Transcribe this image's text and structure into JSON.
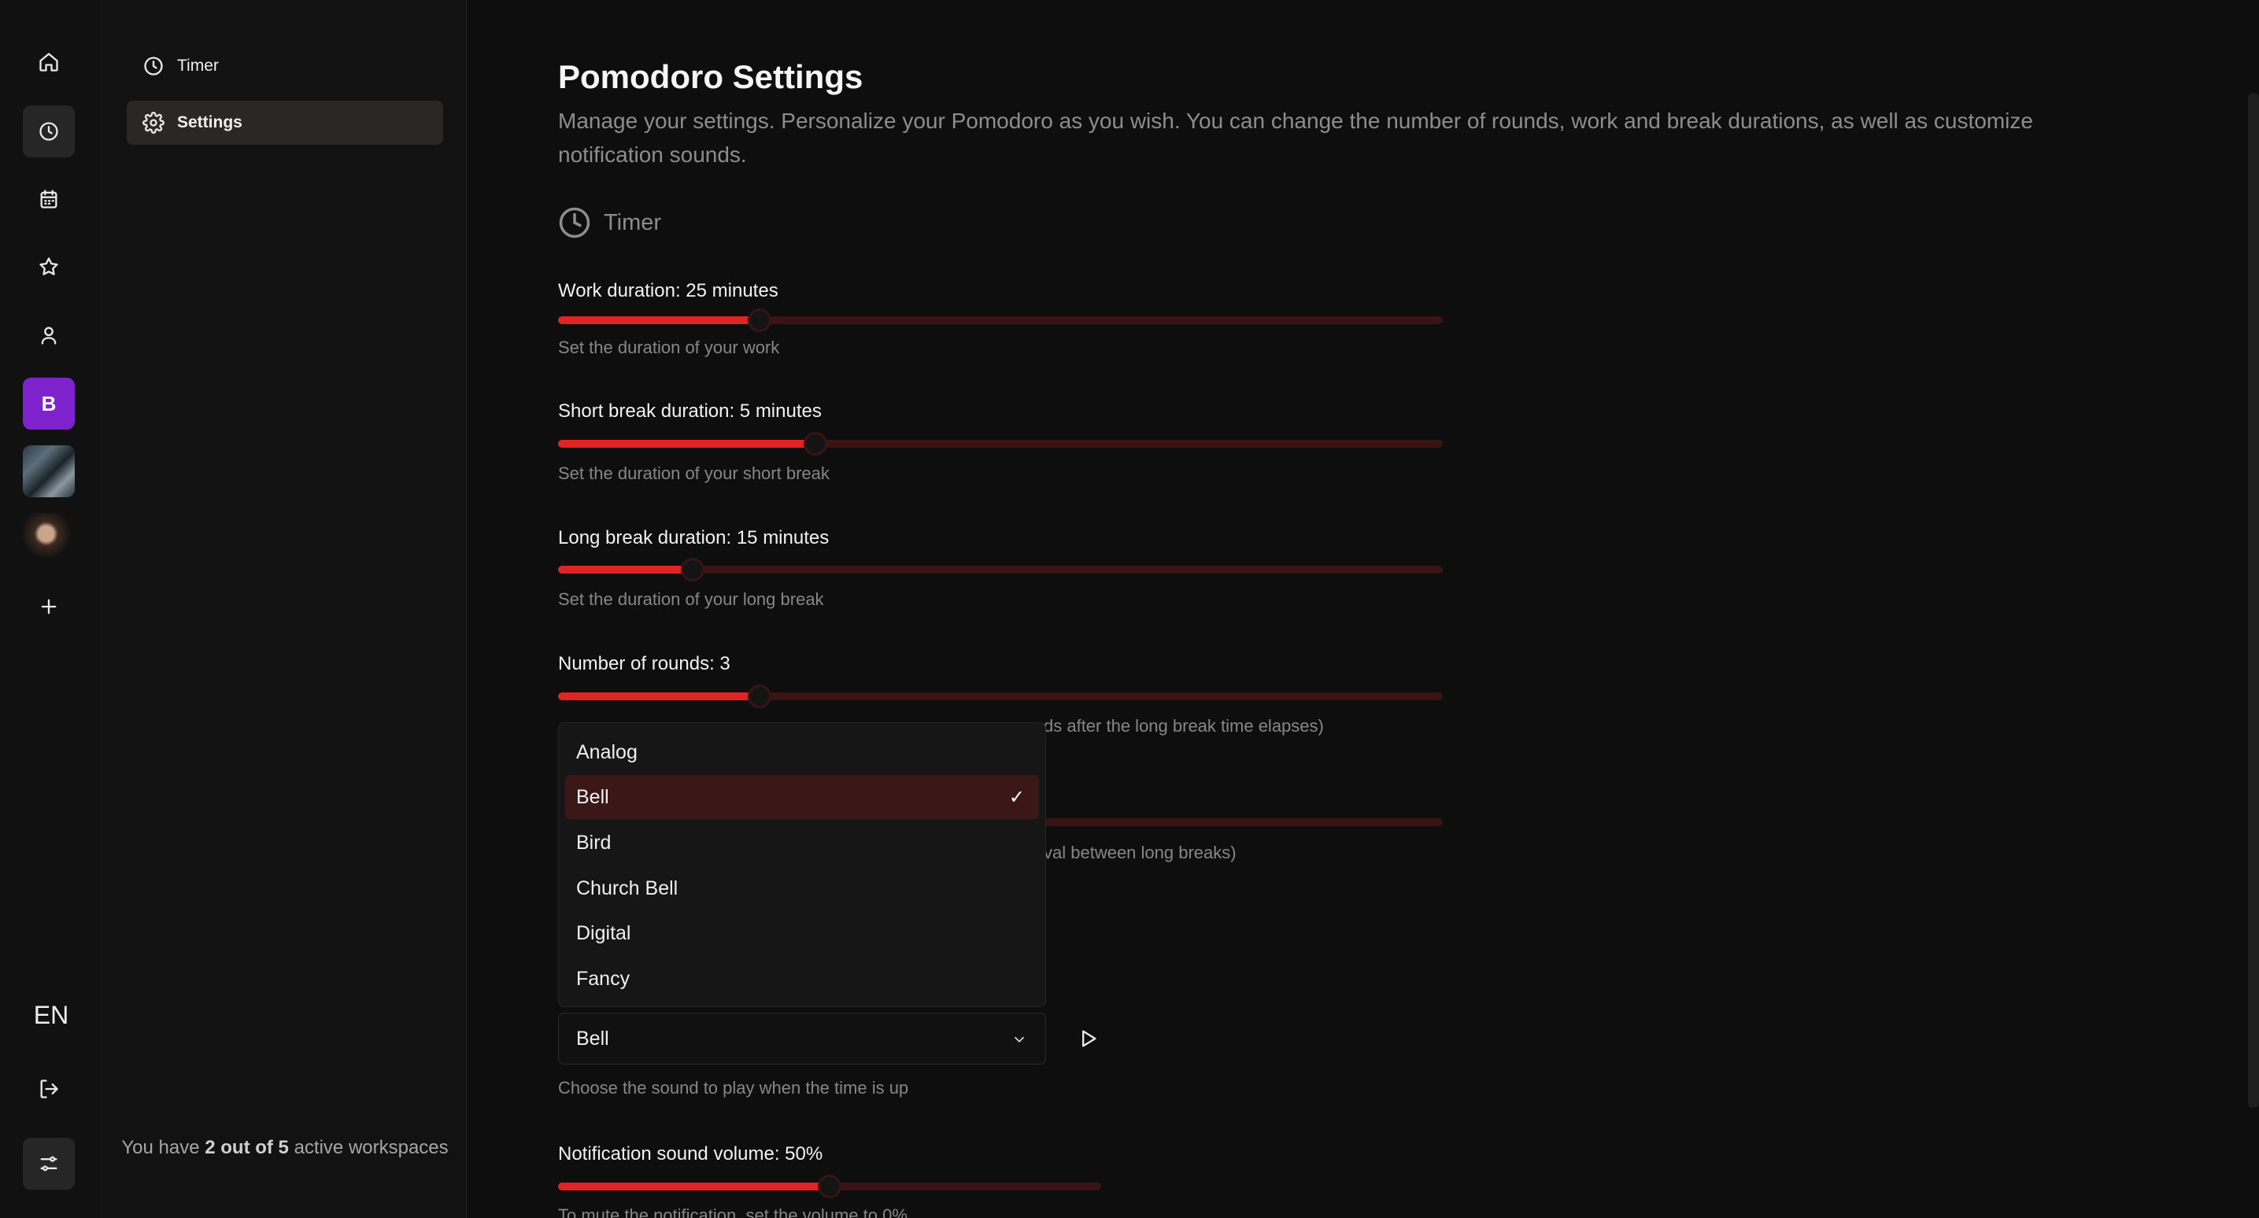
{
  "rail": {
    "lang": "EN",
    "workspace_b": "B"
  },
  "sidebar": {
    "items": [
      {
        "label": "Timer"
      },
      {
        "label": "Settings"
      }
    ],
    "ws_note_prefix": "You have ",
    "ws_note_count": "2 out of 5",
    "ws_note_suffix": " active workspaces"
  },
  "main": {
    "title": "Pomodoro Settings",
    "description": "Manage your settings. Personalize your Pomodoro as you wish. You can change the number of rounds, work and break durations, as well as customize notification sounds.",
    "section": "Timer",
    "sliders": [
      {
        "label": "Work duration: 25 minutes",
        "hint": "Set the duration of your work",
        "fraction": 0.228
      },
      {
        "label": "Short break duration: 5 minutes",
        "hint": "Set the duration of your short break",
        "fraction": 0.291
      },
      {
        "label": "Long break duration: 15 minutes",
        "hint": "Set the duration of your long break",
        "fraction": 0.152
      },
      {
        "label": "Number of rounds: 3",
        "hint_tail": "ds after the long break time elapses)",
        "fraction": 0.228
      },
      {
        "hint_tail": "val between long breaks)"
      }
    ],
    "sound": {
      "options": [
        "Analog",
        "Bell",
        "Bird",
        "Church Bell",
        "Digital",
        "Fancy"
      ],
      "selected": "Bell",
      "check": "✓",
      "hint": "Choose the sound to play when the time is up"
    },
    "volume": {
      "label": "Notification sound volume: 50%",
      "value_percent": 50,
      "hint": "To mute the notification, set the volume to 0%"
    }
  },
  "colors": {
    "accent": "#e02424",
    "track": "#3a1414",
    "workspace_b": "#7e22ce"
  }
}
